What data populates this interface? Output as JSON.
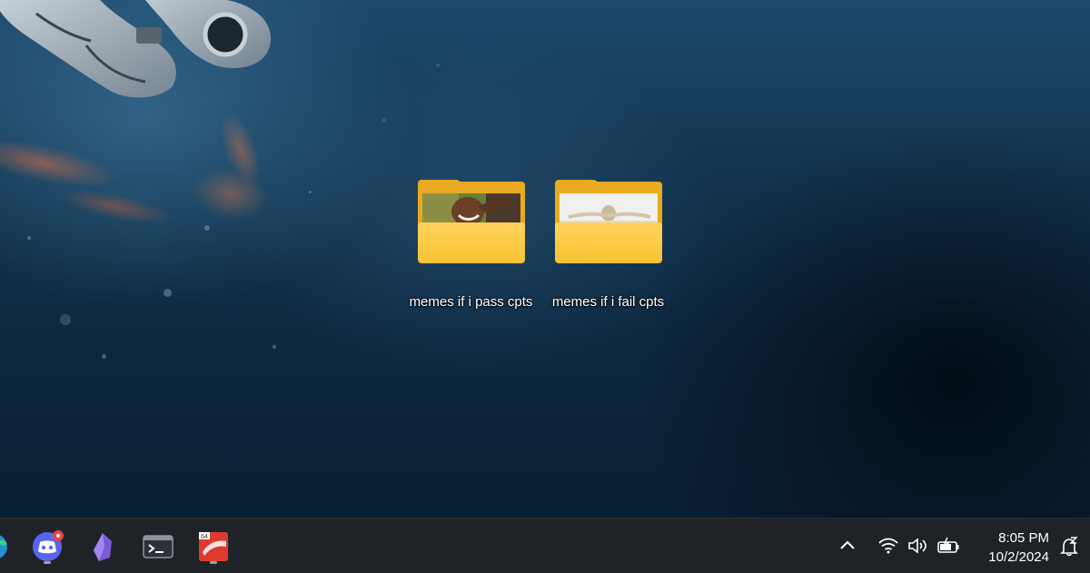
{
  "desktop": {
    "icons": [
      {
        "label": "memes if i pass cpts",
        "icon": "folder-icon"
      },
      {
        "label": "memes if i fail cpts",
        "icon": "folder-icon"
      }
    ]
  },
  "taskbar": {
    "apps": [
      {
        "name": "edge-icon"
      },
      {
        "name": "discord-icon",
        "badge": true
      },
      {
        "name": "obsidian-icon"
      },
      {
        "name": "terminal-icon"
      },
      {
        "name": "kali-64-icon",
        "badge_text": "64"
      }
    ],
    "tray": {
      "icons": [
        "chevron-up-icon",
        "wifi-icon",
        "volume-icon",
        "battery-icon",
        "notification-icon"
      ],
      "time": "8:05 PM",
      "date": "10/2/2024"
    }
  },
  "colors": {
    "taskbar_bg": "#1f2328",
    "folder_yellow": "#f7c234",
    "discord_blue": "#5865f2",
    "badge_red": "#e8473f"
  }
}
